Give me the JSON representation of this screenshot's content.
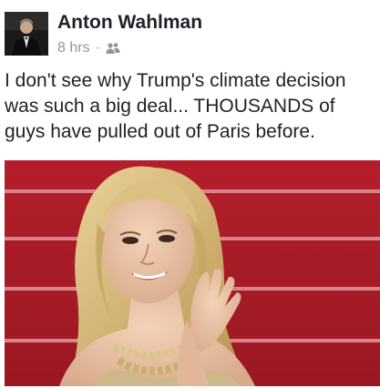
{
  "post": {
    "author": "Anton Wahlman",
    "timestamp": "8 hrs",
    "separator": "·",
    "audience_icon": "friends-icon",
    "text_lines": [
      "I don't see why Trump's climate decision",
      "was such a big deal... THOUSANDS of",
      "guys have pulled out of Paris before."
    ],
    "image_subject": "photo-woman-red-carpet"
  },
  "colors": {
    "text": "#1d2129",
    "meta": "#90949c",
    "backdrop_red": "#b01e2a"
  }
}
